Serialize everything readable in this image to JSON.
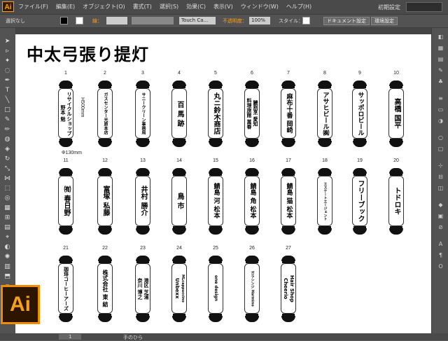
{
  "app": {
    "badge": "Ai",
    "workspace": "初期設定"
  },
  "menu": [
    "ファイル(F)",
    "編集(E)",
    "オブジェクト(O)",
    "書式(T)",
    "選択(S)",
    "効果(C)",
    "表示(V)",
    "ウィンドウ(W)",
    "ヘルプ(H)"
  ],
  "control": {
    "selection": "選択なし",
    "stroke_label": "線：",
    "brush": "Touch Ca...",
    "opacity_label": "不透明度：",
    "opacity": "100%",
    "style_label": "スタイル：",
    "doc_settings": "ドキュメント設定",
    "prefs": "環境設定"
  },
  "status": {
    "zoom": "1",
    "tool": "手のひら"
  },
  "canvas": {
    "title": "中太弓張り提灯",
    "dim_height": "H500mm",
    "dim_width": "Φ130mm",
    "lanterns": [
      {
        "num": "1",
        "lines": [
          "リサイクルショップ",
          "野本 勉"
        ]
      },
      {
        "num": "2",
        "lines": [
          "ガスセンター光原本店"
        ]
      },
      {
        "num": "3",
        "lines": [
          "サニークリーン事務局"
        ]
      },
      {
        "num": "4",
        "lines": [
          "百 馬 跡"
        ]
      },
      {
        "num": "5",
        "lines": [
          "丸ニ鈴木商店"
        ]
      },
      {
        "num": "6",
        "lines": [
          "鰻割烹 愛知",
          "料理旅館 萬春"
        ]
      },
      {
        "num": "7",
        "lines": [
          "麻布十番 岡崎"
        ]
      },
      {
        "num": "8",
        "lines": [
          "アサヒビール㈱"
        ]
      },
      {
        "num": "9",
        "lines": [
          "サッポロビール"
        ]
      },
      {
        "num": "10",
        "lines": [
          "高橋 国平"
        ]
      },
      {
        "num": "11",
        "lines": [
          "㈲ 春日野"
        ]
      },
      {
        "num": "12",
        "lines": [
          "富塚 私藤"
        ]
      },
      {
        "num": "13",
        "lines": [
          "井村 勝介"
        ]
      },
      {
        "num": "14",
        "lines": [
          "鳥 市"
        ]
      },
      {
        "num": "15",
        "lines": [
          "鯖島 河 松本"
        ]
      },
      {
        "num": "16",
        "lines": [
          "鯖島 角 松本"
        ]
      },
      {
        "num": "17",
        "lines": [
          "鯖島 猫 松本"
        ]
      },
      {
        "num": "18",
        "lines": [
          "エスケートエージェント"
        ]
      },
      {
        "num": "19",
        "lines": [
          "フリーブック"
        ]
      },
      {
        "num": "20",
        "lines": [
          "トドロキ"
        ]
      },
      {
        "num": "21",
        "lines": [
          "珈琲コーヒーアーズ"
        ]
      },
      {
        "num": "22",
        "lines": [
          "株式会社 東 結"
        ]
      },
      {
        "num": "23",
        "lines": [
          "港区 芝浦",
          "奈川 博之"
        ]
      },
      {
        "num": "24",
        "lines": [
          "MLcappuccino",
          "Unbexx"
        ]
      },
      {
        "num": "25",
        "lines": [
          "one design"
        ]
      },
      {
        "num": "26",
        "lines": [
          "ガラシンジ Harmino"
        ]
      },
      {
        "num": "27",
        "lines": [
          "Hair Shop",
          "Cheerio"
        ]
      }
    ]
  }
}
